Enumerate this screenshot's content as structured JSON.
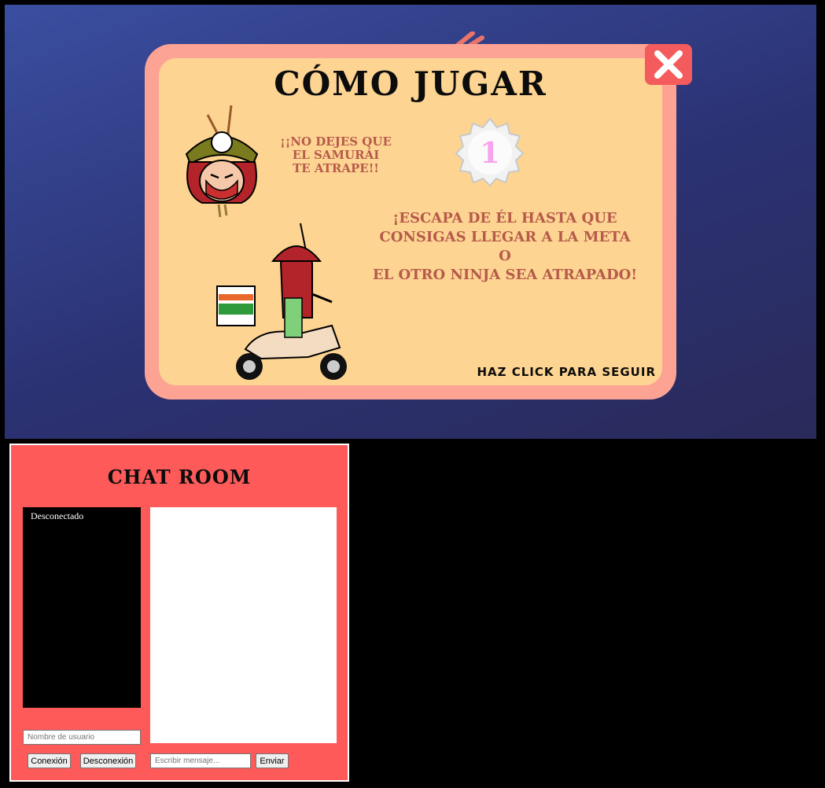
{
  "game": {
    "title": "CÓMO JUGAR",
    "warning_lines": [
      "¡¡NO DEJES QUE",
      "EL SAMURÁI",
      "TE ATRAPE!!"
    ],
    "escape_lines": [
      "¡ESCAPA DE ÉL HASTA QUE",
      "CONSIGAS LLEGAR A LA META",
      "O",
      "EL OTRO NINJA SEA ATRAPADO!"
    ],
    "badge_number": "1",
    "continue_text": "HAZ CLICK PARA SEGUIR",
    "close_icon": "close-icon",
    "colors": {
      "background": "#2b3273",
      "frame": "#fda394",
      "panel": "#fdd491",
      "text_red": "#b65a4b",
      "close_button": "#f45b5d"
    }
  },
  "chat": {
    "title": "CHAT ROOM",
    "status": "Desconectado",
    "username_placeholder": "Nombre de usuario",
    "message_placeholder": "Escribir mensaje...",
    "connect_label": "Conexión",
    "disconnect_label": "Desconexión",
    "send_label": "Enviar",
    "colors": {
      "panel": "#fd5a59",
      "user_list": "#000000",
      "messages": "#ffffff"
    }
  }
}
